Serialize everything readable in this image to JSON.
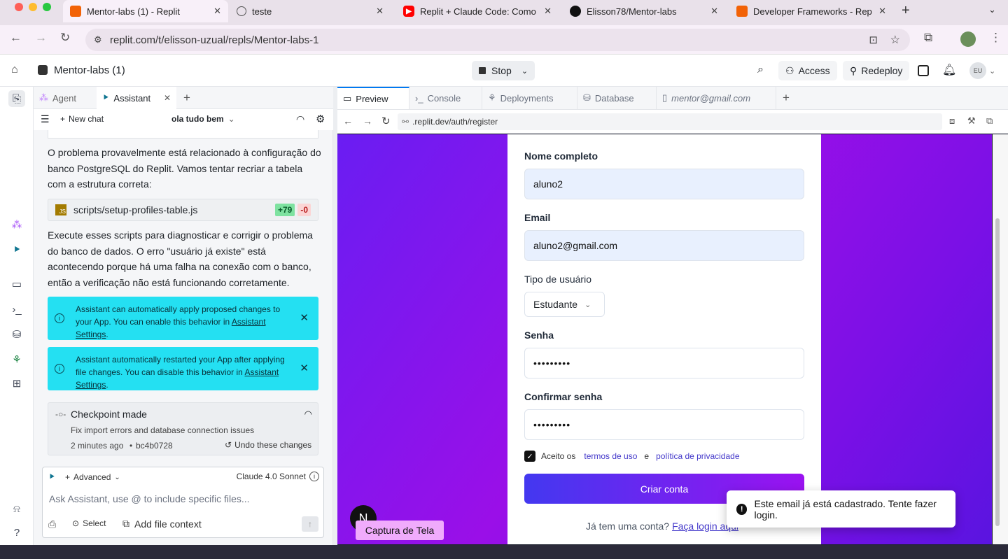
{
  "browser": {
    "tabs": [
      {
        "title": "Mentor-labs (1) - Replit",
        "icon": "replit-icon",
        "active": true
      },
      {
        "title": "teste",
        "icon": "globe-icon",
        "active": false
      },
      {
        "title": "Replit + Claude Code: Como u",
        "icon": "youtube-icon",
        "active": false
      },
      {
        "title": "Elisson78/Mentor-labs",
        "icon": "github-icon",
        "active": false
      },
      {
        "title": "Developer Frameworks - Repl",
        "icon": "replit-icon",
        "active": false
      }
    ],
    "url": "replit.com/t/elisson-uzual/repls/Mentor-labs-1"
  },
  "header": {
    "repl_name": "Mentor-labs (1)",
    "stop_label": "Stop",
    "access_label": "Access",
    "redeploy_label": "Redeploy",
    "avatar": "EU"
  },
  "assistant": {
    "tabs": {
      "agent": "Agent",
      "assistant": "Assistant"
    },
    "new_chat": "New chat",
    "chat_title": "ola tudo bem",
    "msg1": "O problema provavelmente está relacionado à configuração do banco PostgreSQL do Replit. Vamos tentar recriar a tabela com a estrutura correta:",
    "file": {
      "name": "scripts/setup-profiles-table.js",
      "badge": "JS",
      "added": "+79",
      "removed": "-0"
    },
    "msg2": "Execute esses scripts para diagnosticar e corrigir o problema do banco de dados. O erro \"usuário já existe\" está acontecendo porque há uma falha na conexão com o banco, então a verificação não está funcionando corretamente.",
    "info1": {
      "text": "Assistant can automatically apply proposed changes to your App. You can enable this behavior in ",
      "link": "Assistant Settings",
      "end": "."
    },
    "info2": {
      "text": "Assistant automatically restarted your App after applying file changes. You can disable this behavior in ",
      "link": "Assistant Settings",
      "end": "."
    },
    "checkpoint": {
      "title": "Checkpoint made",
      "desc": "Fix import errors and database connection issues",
      "time": "2 minutes ago",
      "hash": "bc4b0728",
      "undo": "Undo these changes"
    },
    "composer": {
      "mode": "Advanced",
      "model": "Claude 4.0 Sonnet",
      "placeholder": "Ask Assistant, use @ to include specific files...",
      "select": "Select",
      "add_context": "Add file context"
    }
  },
  "workspace": {
    "tabs": [
      "Preview",
      "Console",
      "Deployments",
      "Database",
      "mentor@gmail.com"
    ],
    "url": ".replit.dev/auth/register"
  },
  "form": {
    "name_label": "Nome completo",
    "name_value": "aluno2",
    "email_label": "Email",
    "email_value": "aluno2@gmail.com",
    "type_label": "Tipo de usuário",
    "type_value": "Estudante",
    "pwd_label": "Senha",
    "pwd_value": "•••••••••",
    "confirm_label": "Confirmar senha",
    "confirm_value": "•••••••••",
    "terms_prefix": "Aceito os",
    "terms_link": "termos de uso",
    "terms_and": "e",
    "privacy_link": "política de privacidade",
    "submit": "Criar conta",
    "login_prompt": "Já tem uma conta?",
    "login_link": "Faça login aqui"
  },
  "toast": "Este email já está cadastrado. Tente fazer login.",
  "tooltip": "Captura de Tela",
  "nav_badge": "N"
}
